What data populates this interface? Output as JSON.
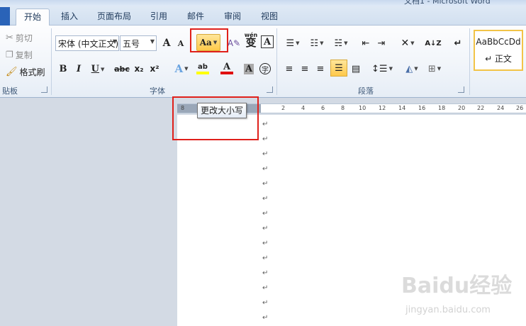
{
  "window": {
    "title": "文档1 - Microsoft Word"
  },
  "tabs": [
    {
      "label": "开始",
      "active": true
    },
    {
      "label": "插入"
    },
    {
      "label": "页面布局"
    },
    {
      "label": "引用"
    },
    {
      "label": "邮件"
    },
    {
      "label": "审阅"
    },
    {
      "label": "视图"
    }
  ],
  "clipboard": {
    "cut": "剪切",
    "copy": "复制",
    "format_painter": "格式刷",
    "group_label": "贴板"
  },
  "font": {
    "font_name": "宋体 (中文正文)",
    "font_size": "五号",
    "change_case_label": "Aa",
    "group_label": "字体",
    "bold": "B",
    "italic": "I",
    "underline": "U",
    "strike": "abc",
    "subscript": "x₂",
    "superscript": "x²",
    "grow": "A",
    "shrink": "A",
    "phonetic": "wén",
    "phonetic_char": "变",
    "char_border": "A",
    "text_effect": "A",
    "highlight": "ab",
    "font_color": "A",
    "char_shading": "A",
    "enclose": "字"
  },
  "paragraph": {
    "group_label": "段落"
  },
  "styles": {
    "preview": "AaBbCcDd",
    "name": "↵ 正文"
  },
  "tooltip": {
    "text": "更改大小写"
  },
  "ruler": {
    "ticks": [
      "8",
      "2",
      "4",
      "6",
      "8",
      "10",
      "12",
      "14",
      "16",
      "18",
      "20",
      "22",
      "24",
      "26"
    ]
  },
  "document": {
    "paragraph_mark": "↵"
  },
  "watermark": {
    "text": "Baidu经验",
    "url": "jingyan.baidu.com"
  },
  "colors": {
    "highlight_yellow": "#ffff00",
    "font_red": "#e01010",
    "red_box": "#e0201b",
    "style_border": "#f2c447"
  },
  "icons": [
    "scissors-icon",
    "copy-icon",
    "format-painter-icon",
    "grow-font-icon",
    "shrink-font-icon",
    "change-case-icon",
    "clear-format-icon",
    "bullets-icon",
    "numbering-icon",
    "multilevel-icon",
    "decrease-indent-icon",
    "increase-indent-icon",
    "chinese-layout-icon",
    "sort-icon",
    "show-marks-icon",
    "align-left-icon",
    "align-center-icon",
    "align-right-icon",
    "justify-icon",
    "distributed-icon",
    "line-spacing-icon",
    "shading-icon",
    "borders-icon"
  ]
}
